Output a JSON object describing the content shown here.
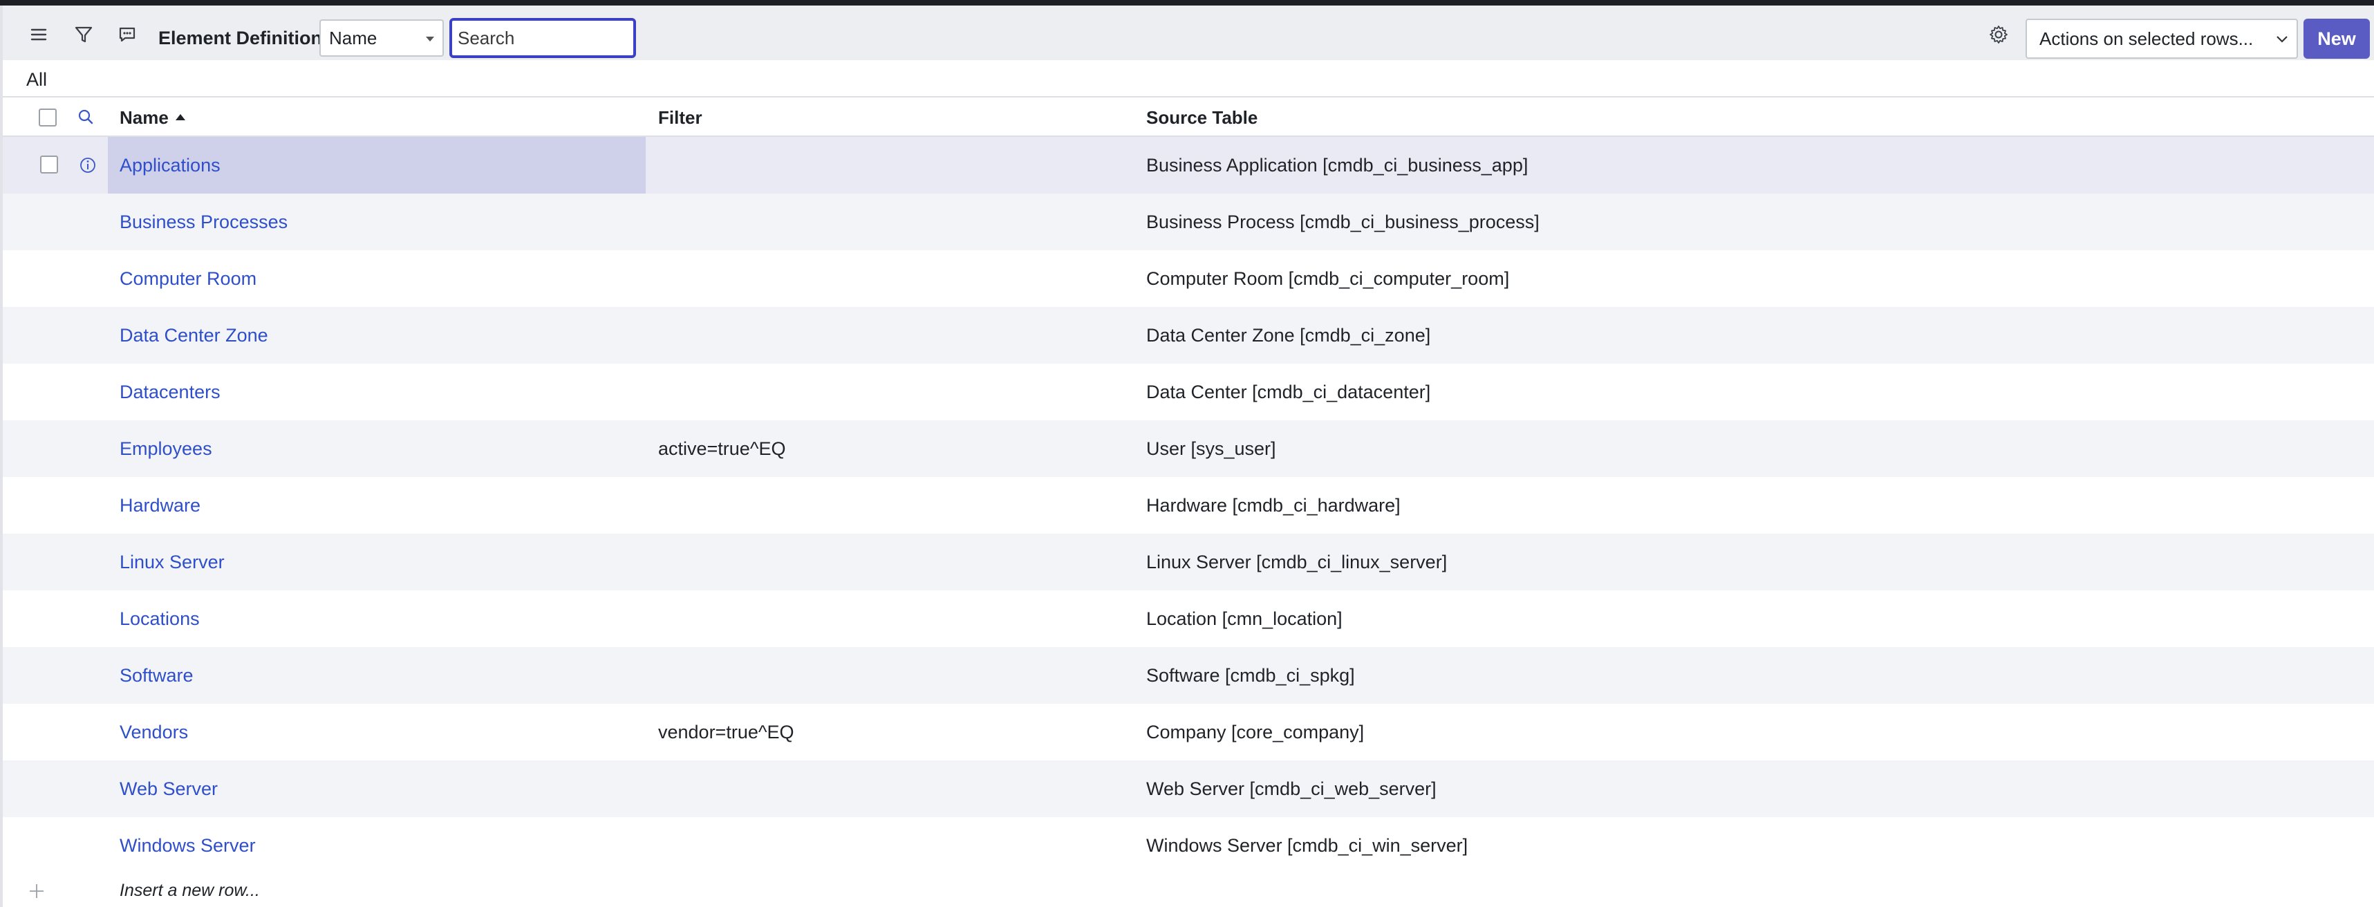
{
  "header": {
    "title": "Element Definitions",
    "search_field_select": "Name",
    "search_placeholder": "Search",
    "actions_select": "Actions on selected rows...",
    "new_button": "New",
    "icons": [
      "menu-icon",
      "filter-icon",
      "comment-icon",
      "gear-icon"
    ]
  },
  "breadcrumb": "All",
  "columns": {
    "name": "Name",
    "filter": "Filter",
    "source_table": "Source Table"
  },
  "sort": {
    "column": "Name",
    "direction": "ascending"
  },
  "rows": [
    {
      "name": "Applications",
      "filter": "",
      "source": "Business Application [cmdb_ci_business_app]"
    },
    {
      "name": "Business Processes",
      "filter": "",
      "source": "Business Process [cmdb_ci_business_process]"
    },
    {
      "name": "Computer Room",
      "filter": "",
      "source": "Computer Room [cmdb_ci_computer_room]"
    },
    {
      "name": "Data Center Zone",
      "filter": "",
      "source": "Data Center Zone [cmdb_ci_zone]"
    },
    {
      "name": "Datacenters",
      "filter": "",
      "source": "Data Center [cmdb_ci_datacenter]"
    },
    {
      "name": "Employees",
      "filter": "active=true^EQ",
      "source": "User [sys_user]"
    },
    {
      "name": "Hardware",
      "filter": "",
      "source": "Hardware [cmdb_ci_hardware]"
    },
    {
      "name": "Linux Server",
      "filter": "",
      "source": "Linux Server [cmdb_ci_linux_server]"
    },
    {
      "name": "Locations",
      "filter": "",
      "source": "Location [cmn_location]"
    },
    {
      "name": "Software",
      "filter": "",
      "source": "Software [cmdb_ci_spkg]"
    },
    {
      "name": "Vendors",
      "filter": "vendor=true^EQ",
      "source": "Company [core_company]"
    },
    {
      "name": "Web Server",
      "filter": "",
      "source": "Web Server [cmdb_ci_web_server]"
    },
    {
      "name": "Windows Server",
      "filter": "",
      "source": "Windows Server [cmdb_ci_win_server]"
    }
  ],
  "insert_row": "Insert a new row...",
  "colors": {
    "accent": "#5b5cc3",
    "link": "#2f4fc9",
    "focus": "#3b40c4"
  }
}
